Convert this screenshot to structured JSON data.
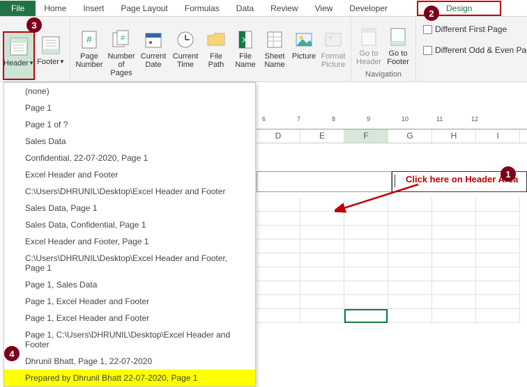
{
  "tabs": {
    "file": "File",
    "home": "Home",
    "insert": "Insert",
    "pageLayout": "Page Layout",
    "formulas": "Formulas",
    "data": "Data",
    "review": "Review",
    "view": "View",
    "developer": "Developer",
    "design": "Design"
  },
  "ribbon": {
    "header": "Header",
    "footer": "Footer",
    "pageNumber": "Page Number",
    "numberOfPages": "Number of Pages",
    "currentDate": "Current Date",
    "currentTime": "Current Time",
    "filePath": "File Path",
    "fileName": "File Name",
    "sheetName": "Sheet Name",
    "picture": "Picture",
    "formatPicture": "Format Picture",
    "goToHeader": "Go to Header",
    "goToFooter": "Go to Footer",
    "navigation": "Navigation",
    "diffFirst": "Different First Page",
    "diffOddEven": "Different Odd & Even Pag"
  },
  "dropdown": [
    "(none)",
    "Page 1",
    "Page 1 of ?",
    "Sales Data",
    " Confidential, 22-07-2020, Page 1",
    "Excel Header and Footer",
    "C:\\Users\\DHRUNIL\\Desktop\\Excel Header and Footer",
    "Sales Data, Page 1",
    "Sales Data,  Confidential, Page 1",
    "Excel Header and Footer, Page 1",
    "C:\\Users\\DHRUNIL\\Desktop\\Excel Header and Footer, Page 1",
    "Page 1, Sales Data",
    "Page 1, Excel Header and Footer",
    "Page 1, Excel Header and Footer",
    "Page 1, C:\\Users\\DHRUNIL\\Desktop\\Excel Header and Footer",
    "Dhrunil Bhatt, Page 1, 22-07-2020",
    "Prepared by Dhrunil Bhatt 22-07-2020, Page 1"
  ],
  "columns": [
    "D",
    "E",
    "F",
    "G",
    "H",
    "I"
  ],
  "rulerTicks": [
    "6",
    "7",
    "8",
    "9",
    "10",
    "11",
    "12"
  ],
  "annotation": "Click here on Header Area",
  "badges": {
    "b1": "1",
    "b2": "2",
    "b3": "3",
    "b4": "4"
  }
}
